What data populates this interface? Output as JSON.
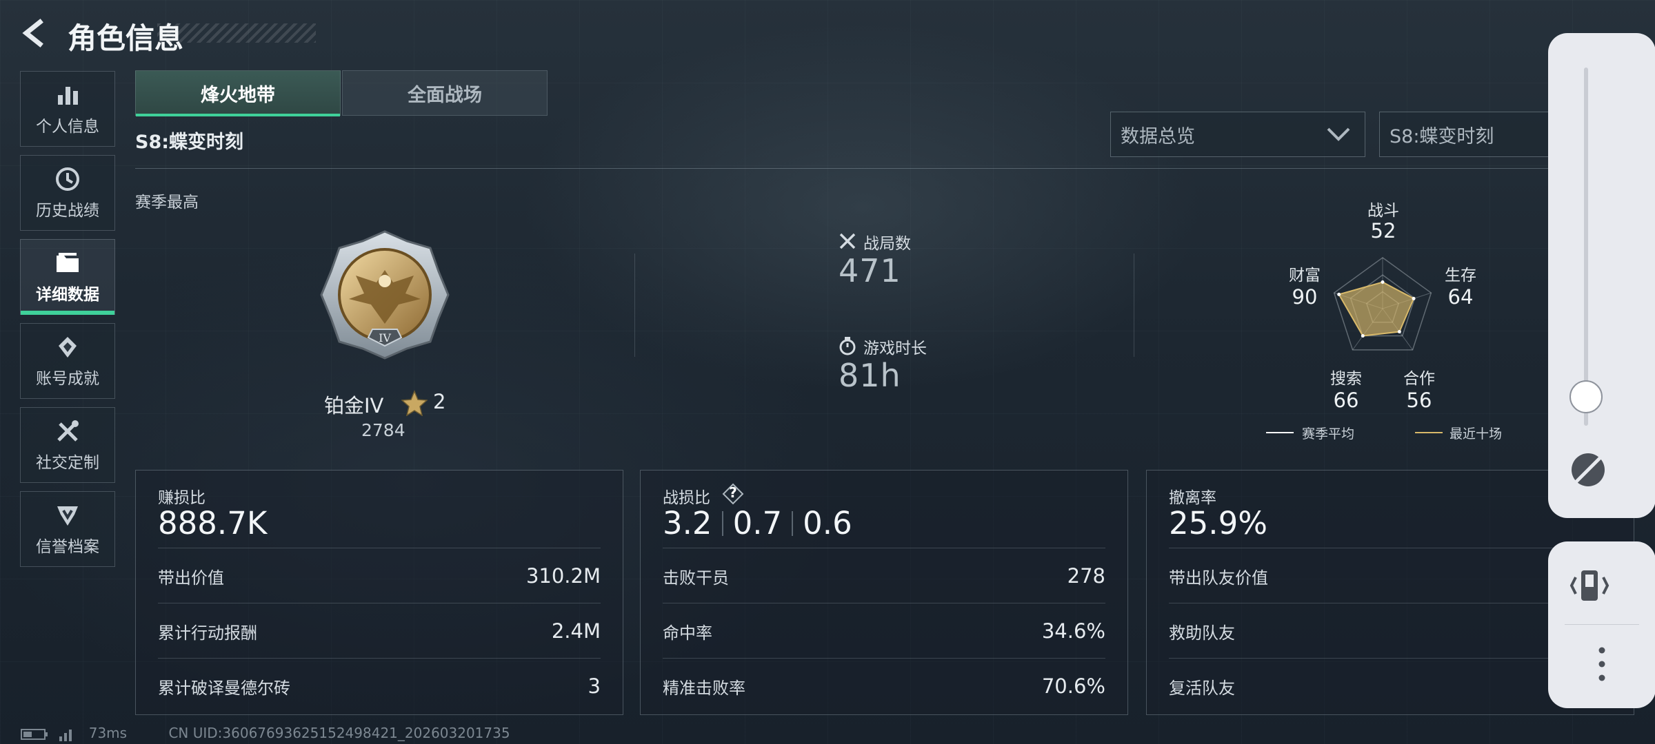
{
  "header": {
    "title": "角色信息"
  },
  "sidebar": {
    "items": [
      {
        "label": "个人信息",
        "icon": "bar-chart-icon"
      },
      {
        "label": "历史战绩",
        "icon": "history-icon"
      },
      {
        "label": "详细数据",
        "icon": "folder-icon",
        "active": true
      },
      {
        "label": "账号成就",
        "icon": "achievement-icon"
      },
      {
        "label": "社交定制",
        "icon": "tools-icon"
      },
      {
        "label": "信誉档案",
        "icon": "credit-icon"
      }
    ]
  },
  "tabs": [
    {
      "label": "烽火地带",
      "active": true
    },
    {
      "label": "全面战场",
      "active": false
    }
  ],
  "season_title": "S8:蝶变时刻",
  "filters": {
    "overview": "数据总览",
    "season": "S8:蝶变时刻"
  },
  "season_best": {
    "label": "赛季最高",
    "badge_numeral": "IV",
    "rank": "铂金IV",
    "stars": "2",
    "score": "2784"
  },
  "stats": {
    "matches_label": "战局数",
    "matches": "471",
    "playtime_label": "游戏时长",
    "playtime": "81h"
  },
  "radar": {
    "axes": [
      {
        "label": "战斗",
        "value": "52"
      },
      {
        "label": "生存",
        "value": "64"
      },
      {
        "label": "合作",
        "value": "56"
      },
      {
        "label": "搜索",
        "value": "66"
      },
      {
        "label": "财富",
        "value": "90"
      }
    ],
    "legend": {
      "season_avg": "赛季平均",
      "recent_ten": "最近十场"
    },
    "colors": {
      "season_avg": "#ffffff",
      "recent_ten": "#d8b96a"
    }
  },
  "panels": [
    {
      "title": "赚损比",
      "big": "888.7K",
      "rows": [
        {
          "k": "带出价值",
          "v": "310.2M"
        },
        {
          "k": "累计行动报酬",
          "v": "2.4M"
        },
        {
          "k": "累计破译曼德尔砖",
          "v": "3"
        }
      ]
    },
    {
      "title": "战损比",
      "help": "?",
      "ratios": [
        "3.2",
        "0.7",
        "0.6"
      ],
      "rows": [
        {
          "k": "击败干员",
          "v": "278"
        },
        {
          "k": "命中率",
          "v": "34.6%"
        },
        {
          "k": "精准击败率",
          "v": "70.6%"
        }
      ]
    },
    {
      "title": "撤离率",
      "big": "25.9%",
      "rows": [
        {
          "k": "带出队友价值",
          "v": ""
        },
        {
          "k": "救助队友",
          "v": ""
        },
        {
          "k": "复活队友",
          "v": ""
        }
      ]
    }
  ],
  "status_bar": {
    "ping": "73ms",
    "uid": "CN UID:36067693625152498421_202603201735"
  },
  "accent": "#3fd19a"
}
